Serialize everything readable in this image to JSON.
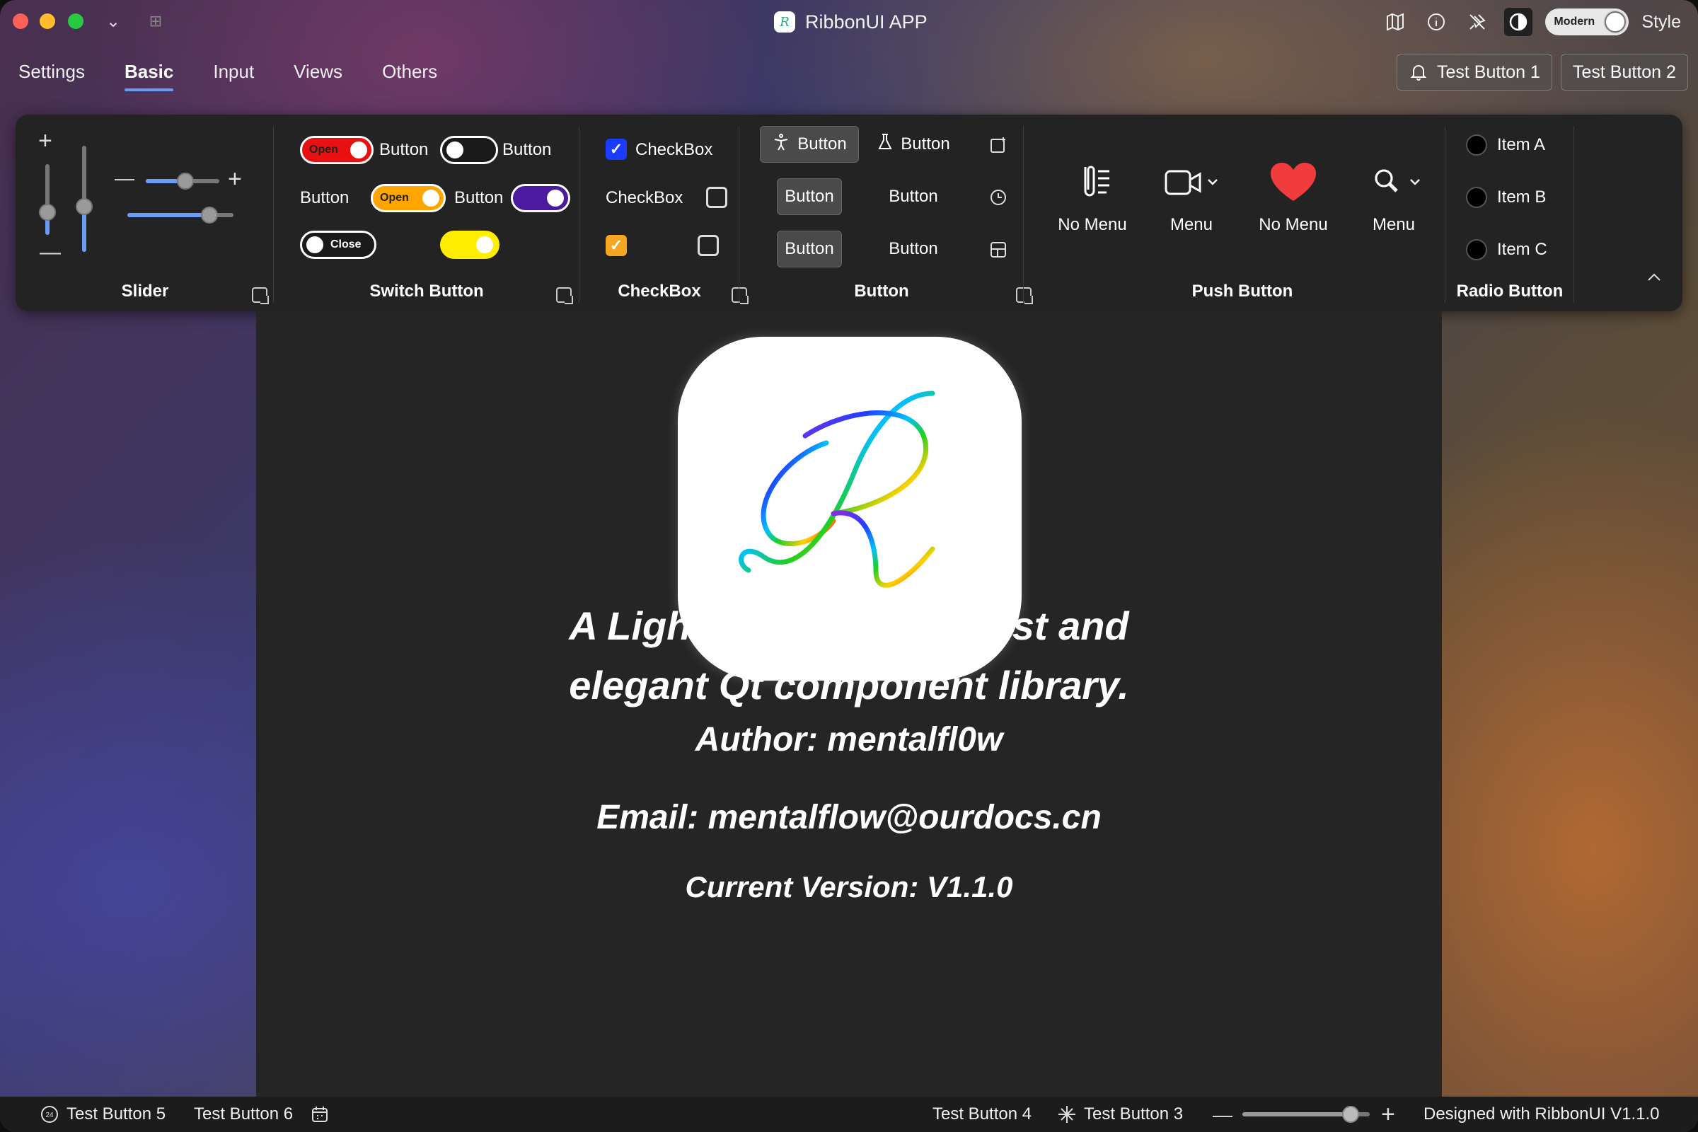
{
  "app": {
    "title": "RibbonUI APP"
  },
  "titlebar": {
    "toggle_label": "Modern",
    "style_label": "Style"
  },
  "tabs": [
    {
      "label": "Settings"
    },
    {
      "label": "Basic"
    },
    {
      "label": "Input"
    },
    {
      "label": "Views"
    },
    {
      "label": "Others"
    }
  ],
  "top_buttons": {
    "b1": "Test Button 1",
    "b2": "Test Button 2"
  },
  "ribbon": {
    "slider": {
      "title": "Slider"
    },
    "switch": {
      "title": "Switch Button",
      "open1": "Open",
      "open2": "Open",
      "close": "Close",
      "lbl_button": "Button"
    },
    "checkbox": {
      "title": "CheckBox",
      "lbl": "CheckBox"
    },
    "button": {
      "title": "Button",
      "lbl": "Button"
    },
    "push": {
      "title": "Push Button",
      "items": [
        "No Menu",
        "Menu",
        "No Menu",
        "Menu"
      ]
    },
    "radio": {
      "title": "Radio Button",
      "items": [
        "Item A",
        "Item B",
        "Item C"
      ]
    }
  },
  "content": {
    "headline1": "A Lightweight, minimalist and",
    "headline2": "elegant Qt component library.",
    "author": "Author: mentalfl0w",
    "email": "Email: mentalflow@ourdocs.cn",
    "version": "Current Version: V1.1.0"
  },
  "statusbar": {
    "tb5": "Test Button 5",
    "tb6": "Test Button 6",
    "tb4": "Test Button 4",
    "tb3": "Test Button 3",
    "designed": "Designed with RibbonUI V1.1.0",
    "zoom": 85
  },
  "colors": {
    "accent": "#6a9cf5",
    "switch_red": "#e81010",
    "switch_orange": "#ffa500",
    "switch_purple": "#4b1a9e",
    "switch_yellow": "#ffee00",
    "checkbox_blue": "#1a3cff",
    "checkbox_orange": "#f5a623",
    "heart": "#f03c3c"
  }
}
